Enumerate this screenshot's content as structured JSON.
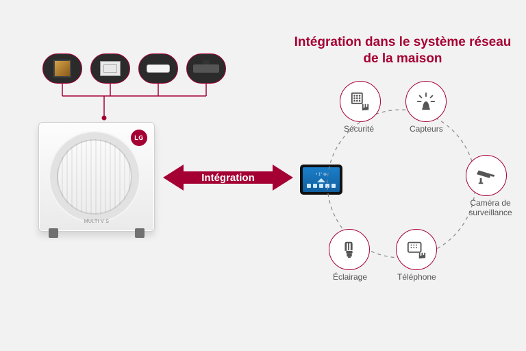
{
  "colors": {
    "brand": "#a50034",
    "iconFill": "#555555"
  },
  "outdoor": {
    "brand": "LG",
    "model": "MULTI V S"
  },
  "indoorUnits": [
    {
      "name": "artcool-frame"
    },
    {
      "name": "ceiling-cassette"
    },
    {
      "name": "wall-mount"
    },
    {
      "name": "ducted"
    }
  ],
  "center": {
    "arrowLabel": "Intégration"
  },
  "networkTitle": "Intégration dans le système réseau de la maison",
  "nodes": {
    "security": {
      "label": "Sécurité",
      "icon": "keypad-touch-icon"
    },
    "sensors": {
      "label": "Capteurs",
      "icon": "alarm-beacon-icon"
    },
    "camera": {
      "label": "Caméra de surveillance",
      "icon": "cctv-camera-icon"
    },
    "phone": {
      "label": "Téléphone",
      "icon": "tablet-touch-icon"
    },
    "lighting": {
      "label": "Éclairage",
      "icon": "cfl-bulb-icon"
    }
  }
}
